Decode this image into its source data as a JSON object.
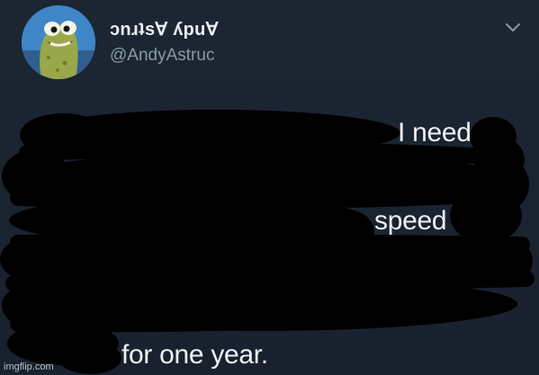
{
  "tweet": {
    "display_name": "ɔnɹʇs∀ ʎpu∀",
    "handle": "@AndyAstruc",
    "menu_icon": "chevron-down-icon",
    "avatar_icon": "cartoon-pickle-avatar"
  },
  "body": {
    "visible_fragments": [
      "I need",
      "speed",
      "for one year."
    ]
  },
  "overlay": {
    "redaction_color": "#000000"
  },
  "watermark": {
    "text": "imgflip.com"
  },
  "colors": {
    "background": "#1b2430",
    "text_primary": "#eef2f5",
    "text_secondary": "#8899a6"
  }
}
